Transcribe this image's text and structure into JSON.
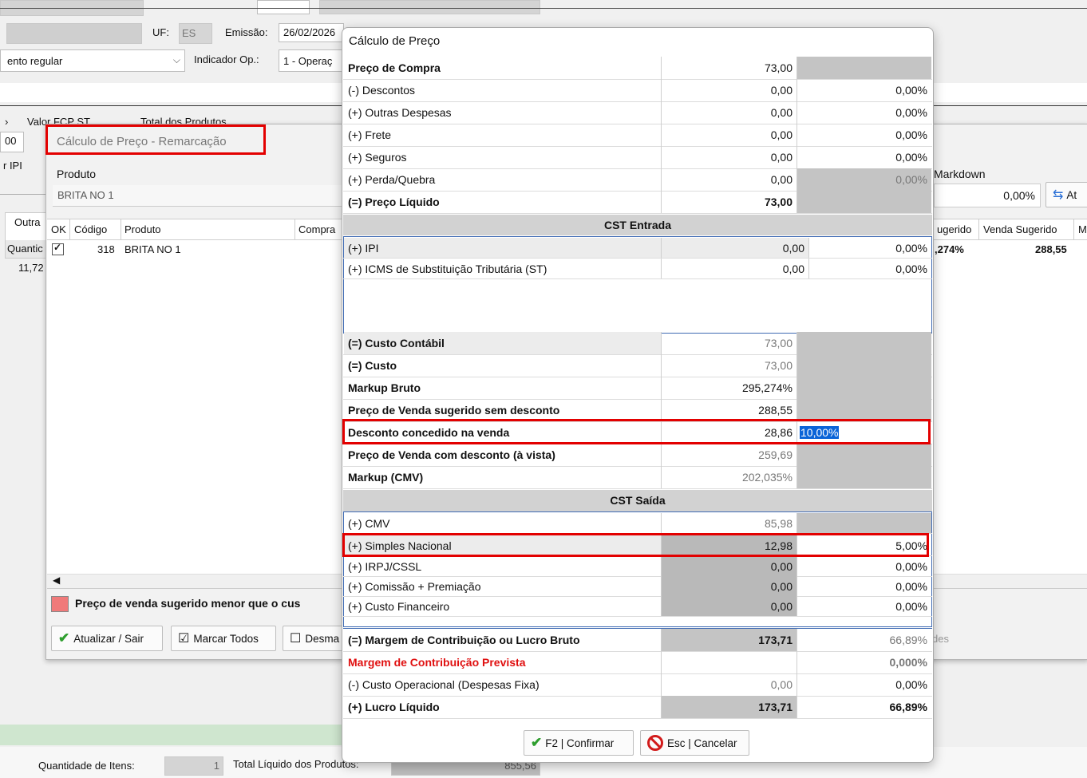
{
  "background": {
    "uf_label": "UF:",
    "uf_value": "ES",
    "emissao_label": "Emissão:",
    "emissao_value": "26/02/2026",
    "tipo_value": "ento regular",
    "indicador_label": "Indicador Op.:",
    "indicador_value": "1 - Operaç",
    "valor_fcp_label": "Valor FCP ST",
    "total_produtos_label": "Total dos Produtos",
    "left_value_00": "00",
    "left_ipi_label": "r IPI",
    "outra_col": "Outra",
    "quantid_label": "Quantic",
    "quant_value": "11,72",
    "quantidade_itens_label": "Quantidade de Itens:",
    "quantidade_itens_value": "1",
    "total_liquido_label": "Total  Líquido dos Produtos:",
    "total_liquido_value": "855,56"
  },
  "remarcacao": {
    "title": "Cálculo de Preço - Remarcação",
    "produto_label": "Produto",
    "produto_value": "BRITA NO 1",
    "markdown_label": "Markdown",
    "markdown_value": "0,00%",
    "atualizar_label": "At",
    "columns": [
      "OK",
      "Código",
      "Produto",
      "Compra"
    ],
    "right_columns": [
      "ugerido",
      "Venda Sugerido",
      "M"
    ],
    "row": {
      "codigo": "318",
      "produto": "BRITA NO 1",
      "markup": ",274%",
      "venda_sugerido": "288,55"
    },
    "warning": "Preço de venda sugerido menor que o cus",
    "btn_atualizar": "Atualizar / Sair",
    "btn_marcar": "Marcar Todos",
    "btn_desmarcar": "Desma",
    "right_trunc": "des"
  },
  "dialog": {
    "title": "Cálculo de Preço",
    "rows_top": [
      {
        "label": "Preço de Compra",
        "value": "73,00",
        "pct": "",
        "bold": true
      },
      {
        "label": "(-) Descontos",
        "value": "0,00",
        "pct": "0,00%"
      },
      {
        "label": "(+) Outras Despesas",
        "value": "0,00",
        "pct": "0,00%"
      },
      {
        "label": "(+) Frete",
        "value": "0,00",
        "pct": "0,00%"
      },
      {
        "label": "(+) Seguros",
        "value": "0,00",
        "pct": "0,00%"
      },
      {
        "label": "(+) Perda/Quebra",
        "value": "0,00",
        "pct": "0,00%"
      },
      {
        "label": "(=) Preço Líquido",
        "value": "73,00",
        "pct": "",
        "bold": true
      }
    ],
    "cst_entrada": "CST Entrada",
    "entrada_rows": [
      {
        "label": "(+) IPI",
        "value": "0,00",
        "pct": "0,00%"
      },
      {
        "label": "(+) ICMS de Substituição Tributária (ST)",
        "value": "0,00",
        "pct": "0,00%"
      }
    ],
    "rows_mid": [
      {
        "label": "(=) Custo Contábil",
        "value": "73,00"
      },
      {
        "label": "(=) Custo",
        "value": "73,00"
      },
      {
        "label": "Markup Bruto",
        "value": "295,274%"
      },
      {
        "label": "Preço de Venda sugerido sem desconto",
        "value": "288,55"
      },
      {
        "label": "Desconto concedido na venda",
        "value": "28,86",
        "pct": "10,00%"
      },
      {
        "label": "Preço de Venda com desconto (à vista)",
        "value": "259,69"
      },
      {
        "label": "Markup (CMV)",
        "value": "202,035%"
      }
    ],
    "cst_saida": "CST Saída",
    "saida_rows": [
      {
        "label": "(+) CMV",
        "value": "85,98",
        "pct": ""
      },
      {
        "label": "(+) Simples Nacional",
        "value": "12,98",
        "pct": "5,00%"
      },
      {
        "label": "(+) IRPJ/CSSL",
        "value": "0,00",
        "pct": "0,00%"
      },
      {
        "label": "(+) Comissão + Premiação",
        "value": "0,00",
        "pct": "0,00%"
      },
      {
        "label": "(+) Custo Financeiro",
        "value": "0,00",
        "pct": "0,00%"
      }
    ],
    "rows_bottom": [
      {
        "label": "(=) Margem de Contribuição ou Lucro Bruto",
        "value": "173,71",
        "pct": "66,89%"
      },
      {
        "label": "Margem de Contribuição Prevista",
        "value": "",
        "pct": "0,000%"
      },
      {
        "label": "(-) Custo Operacional (Despesas Fixa)",
        "value": "0,00",
        "pct": "0,00%"
      },
      {
        "label": "(+) Lucro Líquido",
        "value": "173,71",
        "pct": "66,89%"
      }
    ],
    "btn_confirmar": "F2 | Confirmar",
    "btn_cancelar": "Esc | Cancelar",
    "colors": {
      "highlight_red": "#e30000",
      "selection_blue": "#0a64d8",
      "prevista_red": "#e01010",
      "check_green": "#2e9e2e"
    }
  }
}
